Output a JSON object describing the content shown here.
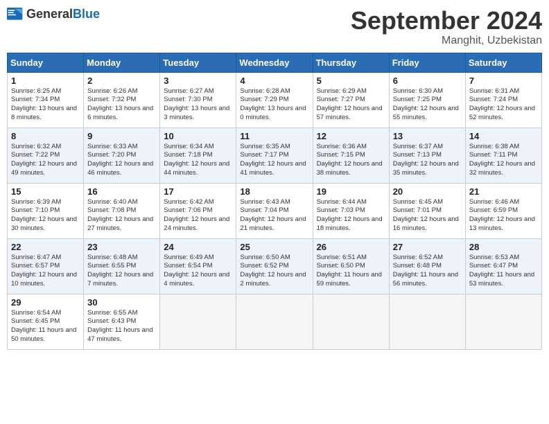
{
  "logo": {
    "general": "General",
    "blue": "Blue"
  },
  "title": {
    "month": "September 2024",
    "location": "Manghit, Uzbekistan"
  },
  "headers": [
    "Sunday",
    "Monday",
    "Tuesday",
    "Wednesday",
    "Thursday",
    "Friday",
    "Saturday"
  ],
  "weeks": [
    [
      {
        "day": "1",
        "sunrise": "6:25 AM",
        "sunset": "7:34 PM",
        "daylight": "13 hours and 8 minutes."
      },
      {
        "day": "2",
        "sunrise": "6:26 AM",
        "sunset": "7:32 PM",
        "daylight": "13 hours and 6 minutes."
      },
      {
        "day": "3",
        "sunrise": "6:27 AM",
        "sunset": "7:30 PM",
        "daylight": "13 hours and 3 minutes."
      },
      {
        "day": "4",
        "sunrise": "6:28 AM",
        "sunset": "7:29 PM",
        "daylight": "13 hours and 0 minutes."
      },
      {
        "day": "5",
        "sunrise": "6:29 AM",
        "sunset": "7:27 PM",
        "daylight": "12 hours and 57 minutes."
      },
      {
        "day": "6",
        "sunrise": "6:30 AM",
        "sunset": "7:25 PM",
        "daylight": "12 hours and 55 minutes."
      },
      {
        "day": "7",
        "sunrise": "6:31 AM",
        "sunset": "7:24 PM",
        "daylight": "12 hours and 52 minutes."
      }
    ],
    [
      {
        "day": "8",
        "sunrise": "6:32 AM",
        "sunset": "7:22 PM",
        "daylight": "12 hours and 49 minutes."
      },
      {
        "day": "9",
        "sunrise": "6:33 AM",
        "sunset": "7:20 PM",
        "daylight": "12 hours and 46 minutes."
      },
      {
        "day": "10",
        "sunrise": "6:34 AM",
        "sunset": "7:18 PM",
        "daylight": "12 hours and 44 minutes."
      },
      {
        "day": "11",
        "sunrise": "6:35 AM",
        "sunset": "7:17 PM",
        "daylight": "12 hours and 41 minutes."
      },
      {
        "day": "12",
        "sunrise": "6:36 AM",
        "sunset": "7:15 PM",
        "daylight": "12 hours and 38 minutes."
      },
      {
        "day": "13",
        "sunrise": "6:37 AM",
        "sunset": "7:13 PM",
        "daylight": "12 hours and 35 minutes."
      },
      {
        "day": "14",
        "sunrise": "6:38 AM",
        "sunset": "7:11 PM",
        "daylight": "12 hours and 32 minutes."
      }
    ],
    [
      {
        "day": "15",
        "sunrise": "6:39 AM",
        "sunset": "7:10 PM",
        "daylight": "12 hours and 30 minutes."
      },
      {
        "day": "16",
        "sunrise": "6:40 AM",
        "sunset": "7:08 PM",
        "daylight": "12 hours and 27 minutes."
      },
      {
        "day": "17",
        "sunrise": "6:42 AM",
        "sunset": "7:06 PM",
        "daylight": "12 hours and 24 minutes."
      },
      {
        "day": "18",
        "sunrise": "6:43 AM",
        "sunset": "7:04 PM",
        "daylight": "12 hours and 21 minutes."
      },
      {
        "day": "19",
        "sunrise": "6:44 AM",
        "sunset": "7:03 PM",
        "daylight": "12 hours and 18 minutes."
      },
      {
        "day": "20",
        "sunrise": "6:45 AM",
        "sunset": "7:01 PM",
        "daylight": "12 hours and 16 minutes."
      },
      {
        "day": "21",
        "sunrise": "6:46 AM",
        "sunset": "6:59 PM",
        "daylight": "12 hours and 13 minutes."
      }
    ],
    [
      {
        "day": "22",
        "sunrise": "6:47 AM",
        "sunset": "6:57 PM",
        "daylight": "12 hours and 10 minutes."
      },
      {
        "day": "23",
        "sunrise": "6:48 AM",
        "sunset": "6:55 PM",
        "daylight": "12 hours and 7 minutes."
      },
      {
        "day": "24",
        "sunrise": "6:49 AM",
        "sunset": "6:54 PM",
        "daylight": "12 hours and 4 minutes."
      },
      {
        "day": "25",
        "sunrise": "6:50 AM",
        "sunset": "6:52 PM",
        "daylight": "12 hours and 2 minutes."
      },
      {
        "day": "26",
        "sunrise": "6:51 AM",
        "sunset": "6:50 PM",
        "daylight": "11 hours and 59 minutes."
      },
      {
        "day": "27",
        "sunrise": "6:52 AM",
        "sunset": "6:48 PM",
        "daylight": "11 hours and 56 minutes."
      },
      {
        "day": "28",
        "sunrise": "6:53 AM",
        "sunset": "6:47 PM",
        "daylight": "11 hours and 53 minutes."
      }
    ],
    [
      {
        "day": "29",
        "sunrise": "6:54 AM",
        "sunset": "6:45 PM",
        "daylight": "11 hours and 50 minutes."
      },
      {
        "day": "30",
        "sunrise": "6:55 AM",
        "sunset": "6:43 PM",
        "daylight": "11 hours and 47 minutes."
      },
      null,
      null,
      null,
      null,
      null
    ]
  ]
}
